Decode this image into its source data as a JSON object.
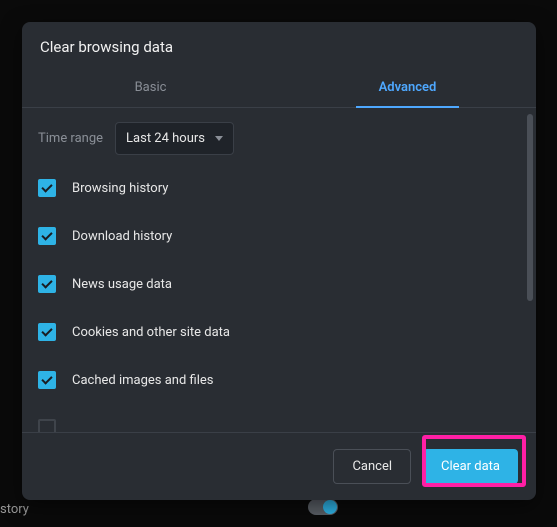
{
  "modal": {
    "title": "Clear browsing data",
    "tabs": {
      "basic": "Basic",
      "advanced": "Advanced"
    },
    "time_range": {
      "label": "Time range",
      "value": "Last 24 hours"
    },
    "items": [
      {
        "label": "Browsing history"
      },
      {
        "label": "Download history"
      },
      {
        "label": "News usage data"
      },
      {
        "label": "Cookies and other site data"
      },
      {
        "label": "Cached images and files"
      }
    ],
    "footer": {
      "cancel": "Cancel",
      "clear": "Clear data"
    }
  },
  "background": {
    "partial_text": "story"
  }
}
